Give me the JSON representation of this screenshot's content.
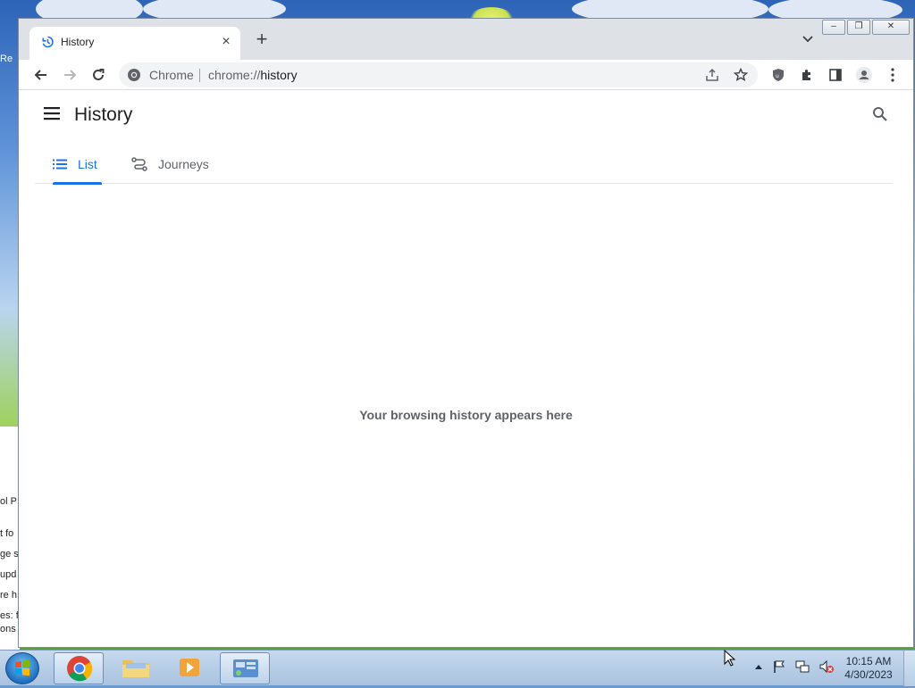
{
  "desktop": {
    "left_edge_fragments": [
      "Re",
      "ol P",
      "t fo",
      "ge s",
      "upd",
      "re h",
      "es: f",
      "ons"
    ]
  },
  "window": {
    "controls": {
      "minimize": "–",
      "restore": "❐",
      "close": "✕"
    }
  },
  "tab": {
    "title": "History",
    "close_icon": "close-icon",
    "new_tab_label": "+"
  },
  "toolbar": {
    "site_label": "Chrome",
    "url_prefix": "chrome://",
    "url_path": "history"
  },
  "page": {
    "title": "History",
    "tabs": [
      {
        "label": "List",
        "selected": true
      },
      {
        "label": "Journeys",
        "selected": false
      }
    ],
    "empty_message": "Your browsing history appears here"
  },
  "taskbar": {
    "time": "10:15 AM",
    "date": "4/30/2023"
  },
  "colors": {
    "accent": "#1a73e8",
    "tab_strip": "#dee1e6",
    "omnibox": "#f1f3f4",
    "secondary_text": "#5f6368"
  }
}
